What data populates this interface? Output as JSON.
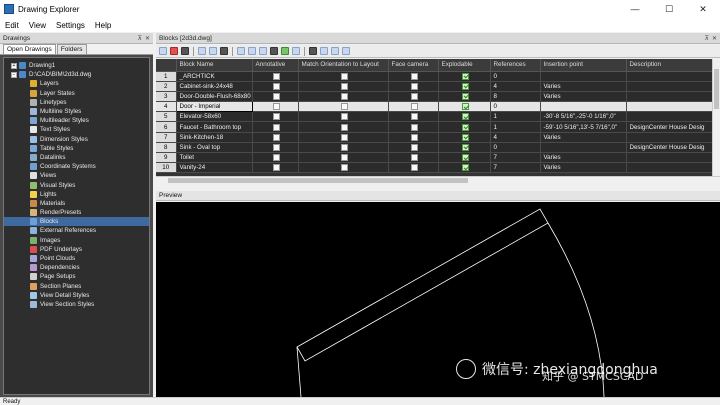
{
  "window": {
    "title": "Drawing Explorer",
    "minimize": "—",
    "maximize": "☐",
    "close": "✕"
  },
  "menu": [
    "Edit",
    "View",
    "Settings",
    "Help"
  ],
  "drawings_panel": {
    "header": "Drawings",
    "tabs": [
      "Open Drawings",
      "Folders"
    ],
    "tree": {
      "root": "Drawing1",
      "file": "D:\\CAD\\BIM\\2d3d.dwg",
      "items": [
        {
          "label": "Layers",
          "color": "#e0b030"
        },
        {
          "label": "Layer States",
          "color": "#d9a43a"
        },
        {
          "label": "Linetypes",
          "color": "#b0b0b0"
        },
        {
          "label": "Multiline Styles",
          "color": "#9fb7d8"
        },
        {
          "label": "Multileader Styles",
          "color": "#7fa5d6"
        },
        {
          "label": "Text Styles",
          "color": "#e8e8e8"
        },
        {
          "label": "Dimension Styles",
          "color": "#9ac0e6"
        },
        {
          "label": "Table Styles",
          "color": "#7aa6d9"
        },
        {
          "label": "Datalinks",
          "color": "#88aacc"
        },
        {
          "label": "Coordinate Systems",
          "color": "#6fa0cf"
        },
        {
          "label": "Views",
          "color": "#e0e0e0"
        },
        {
          "label": "Visual Styles",
          "color": "#8fbf6f"
        },
        {
          "label": "Lights",
          "color": "#f2d24a"
        },
        {
          "label": "Materials",
          "color": "#c98a4a"
        },
        {
          "label": "RenderPresets",
          "color": "#d7b47a"
        },
        {
          "label": "Blocks",
          "color": "#6f9fd8"
        },
        {
          "label": "External References",
          "color": "#8cb4e0"
        },
        {
          "label": "Images",
          "color": "#7fb06c"
        },
        {
          "label": "PDF Underlays",
          "color": "#d85050"
        },
        {
          "label": "Point Clouds",
          "color": "#a8a8d8"
        },
        {
          "label": "Dependencies",
          "color": "#b89ad0"
        },
        {
          "label": "Page Setups",
          "color": "#d0d0d0"
        },
        {
          "label": "Section Planes",
          "color": "#e0a060"
        },
        {
          "label": "View Detail Styles",
          "color": "#9fc8e8"
        },
        {
          "label": "View Section Styles",
          "color": "#a0b8d8"
        }
      ],
      "selected_index": 15
    }
  },
  "blocks_panel": {
    "header": "Blocks [2d3d.dwg]",
    "columns": [
      "",
      "Block Name",
      "Annotative",
      "Match Orientation to Layout",
      "Face camera",
      "Explodable",
      "References",
      "Insertion point",
      "Description"
    ],
    "rows": [
      {
        "n": "1",
        "name": "_ARCHTICK",
        "annotative": false,
        "match": false,
        "face": false,
        "explodable": true,
        "refs": "0",
        "insertion": "",
        "desc": ""
      },
      {
        "n": "2",
        "name": "Cabinet-sink-24x48",
        "annotative": false,
        "match": false,
        "face": false,
        "explodable": true,
        "refs": "4",
        "insertion": "Varies",
        "desc": ""
      },
      {
        "n": "3",
        "name": "Door-Double-Flush-68x80",
        "annotative": false,
        "match": false,
        "face": false,
        "explodable": true,
        "refs": "8",
        "insertion": "Varies",
        "desc": ""
      },
      {
        "n": "4",
        "name": "Door - Imperial",
        "annotative": false,
        "match": false,
        "face": false,
        "explodable": true,
        "refs": "0",
        "insertion": "",
        "desc": ""
      },
      {
        "n": "5",
        "name": "Elevator-58x60",
        "annotative": false,
        "match": false,
        "face": false,
        "explodable": true,
        "refs": "1",
        "insertion": "-30'-8 5/16\",-25'-0 1/16\",0\"",
        "desc": ""
      },
      {
        "n": "6",
        "name": "Faucet - Bathroom top",
        "annotative": false,
        "match": false,
        "face": false,
        "explodable": true,
        "refs": "1",
        "insertion": "-59'-10 5/16\",13'-5 7/16\",0\"",
        "desc": "DesignCenter House Desig"
      },
      {
        "n": "7",
        "name": "Sink-Kitchen-18",
        "annotative": false,
        "match": false,
        "face": false,
        "explodable": true,
        "refs": "4",
        "insertion": "Varies",
        "desc": ""
      },
      {
        "n": "8",
        "name": "Sink - Oval top",
        "annotative": false,
        "match": false,
        "face": false,
        "explodable": true,
        "refs": "0",
        "insertion": "",
        "desc": "DesignCenter House Desig"
      },
      {
        "n": "9",
        "name": "Toilet",
        "annotative": false,
        "match": false,
        "face": false,
        "explodable": true,
        "refs": "7",
        "insertion": "Varies",
        "desc": ""
      },
      {
        "n": "10",
        "name": "Vanity-24",
        "annotative": false,
        "match": false,
        "face": false,
        "explodable": true,
        "refs": "7",
        "insertion": "Varies",
        "desc": ""
      }
    ],
    "selected_row": 3
  },
  "preview": {
    "header": "Preview",
    "stroke_color": "#ffffff"
  },
  "watermark": {
    "wechat": "微信号: zhexiangdonghua",
    "zhihu": "知乎 @ STMCSCAD"
  },
  "status": "Ready",
  "colors": {
    "selection": "#3f6aa0",
    "panel_dark": "#2e2e2e"
  }
}
